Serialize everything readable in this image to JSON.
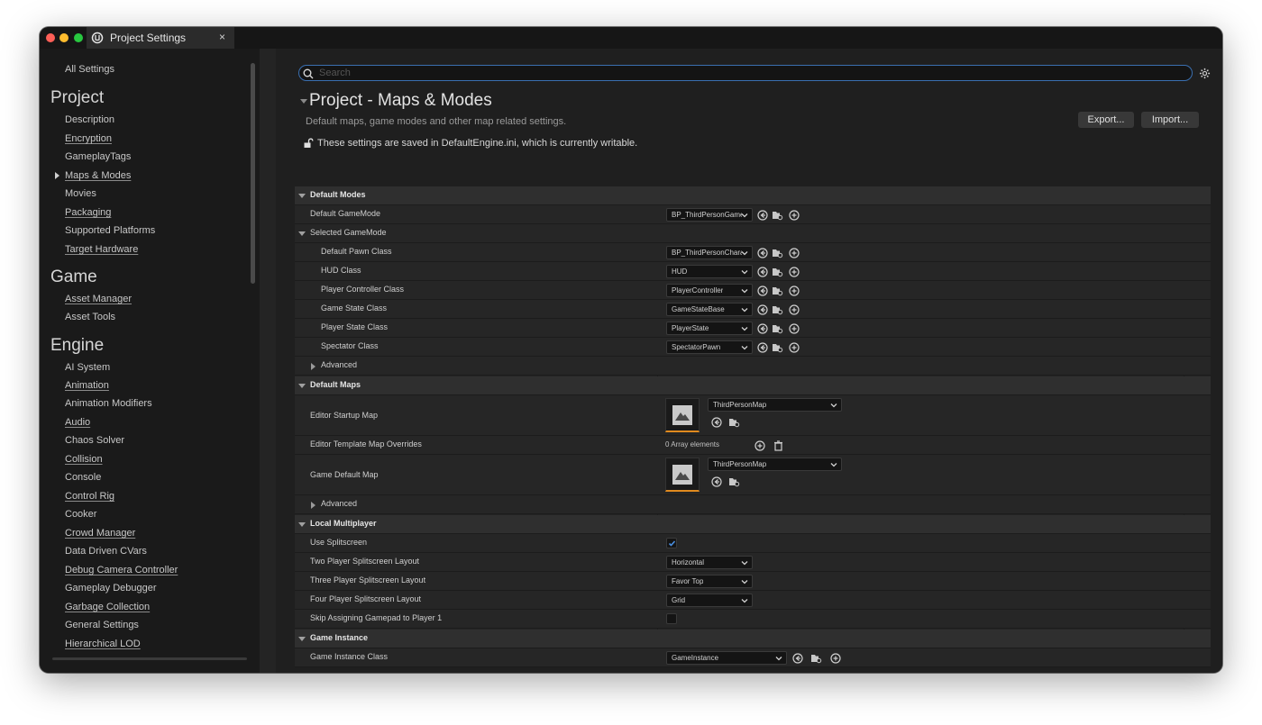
{
  "window": {
    "tab_title": "Project Settings",
    "close_glyph": "×"
  },
  "sidebar": {
    "all_settings": "All Settings",
    "sections": [
      {
        "heading": "Project",
        "items": [
          "Description",
          "Encryption",
          "GameplayTags",
          "Maps & Modes",
          "Movies",
          "Packaging",
          "Supported Platforms",
          "Target Hardware"
        ]
      },
      {
        "heading": "Game",
        "items": [
          "Asset Manager",
          "Asset Tools"
        ]
      },
      {
        "heading": "Engine",
        "items": [
          "AI System",
          "Animation",
          "Animation Modifiers",
          "Audio",
          "Chaos Solver",
          "Collision",
          "Console",
          "Control Rig",
          "Cooker",
          "Crowd Manager",
          "Data Driven CVars",
          "Debug Camera Controller",
          "Gameplay Debugger",
          "Garbage Collection",
          "General Settings",
          "Hierarchical LOD"
        ]
      }
    ],
    "selected": "Maps & Modes"
  },
  "search": {
    "placeholder": "Search",
    "value": ""
  },
  "header": {
    "title": "Project - Maps & Modes",
    "description": "Default maps, game modes and other map related settings.",
    "export_label": "Export...",
    "import_label": "Import...",
    "saved_note": "These settings are saved in DefaultEngine.ini, which is currently writable."
  },
  "grid": {
    "default_modes": {
      "heading": "Default Modes",
      "default_gamemode_label": "Default GameMode",
      "default_gamemode_value": "BP_ThirdPersonGameMode",
      "selected_gamemode_heading": "Selected GameMode",
      "default_pawn_label": "Default Pawn Class",
      "default_pawn_value": "BP_ThirdPersonCharacter",
      "hud_label": "HUD Class",
      "hud_value": "HUD",
      "player_controller_label": "Player Controller Class",
      "player_controller_value": "PlayerController",
      "game_state_label": "Game State Class",
      "game_state_value": "GameStateBase",
      "player_state_label": "Player State Class",
      "player_state_value": "PlayerState",
      "spectator_label": "Spectator Class",
      "spectator_value": "SpectatorPawn",
      "advanced_label": "Advanced"
    },
    "default_maps": {
      "heading": "Default Maps",
      "editor_startup_label": "Editor Startup Map",
      "editor_startup_value": "ThirdPersonMap",
      "editor_template_label": "Editor Template Map Overrides",
      "editor_template_value": "0 Array elements",
      "game_default_label": "Game Default Map",
      "game_default_value": "ThirdPersonMap",
      "advanced_label": "Advanced"
    },
    "local_multiplayer": {
      "heading": "Local Multiplayer",
      "use_splitscreen_label": "Use Splitscreen",
      "use_splitscreen_checked": true,
      "two_player_label": "Two Player Splitscreen Layout",
      "two_player_value": "Horizontal",
      "three_player_label": "Three Player Splitscreen Layout",
      "three_player_value": "Favor Top",
      "four_player_label": "Four Player Splitscreen Layout",
      "four_player_value": "Grid",
      "skip_gamepad_label": "Skip Assigning Gamepad to Player 1",
      "skip_gamepad_checked": false
    },
    "game_instance": {
      "heading": "Game Instance",
      "class_label": "Game Instance Class",
      "class_value": "GameInstance"
    }
  },
  "colors": {
    "accent": "#3a6fb0",
    "thumb_underline": "#e08a1e",
    "checkbox_check": "#4a8fe0"
  },
  "icons": [
    "ue-logo-icon",
    "search-icon",
    "gear-icon",
    "lock-icon",
    "browse-back-icon",
    "browse-folder-icon",
    "add-icon",
    "delete-icon",
    "chevron-down-icon",
    "map-thumbnail-icon",
    "check-icon"
  ]
}
